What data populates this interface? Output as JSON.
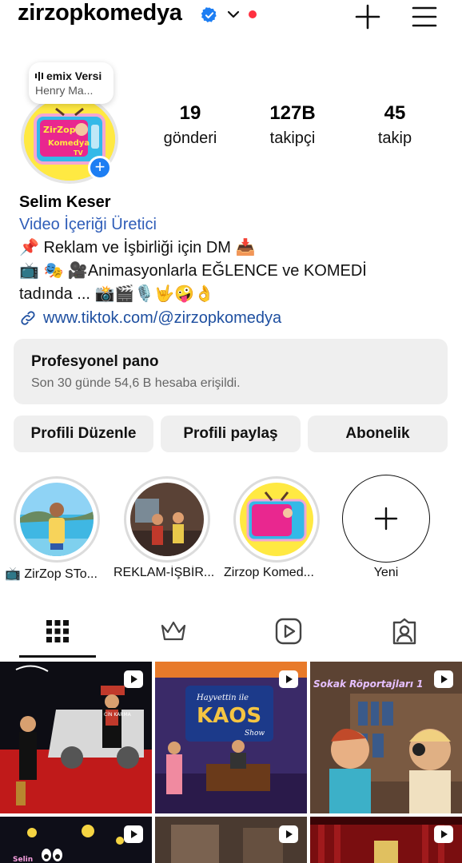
{
  "header": {
    "username": "zirzopkomedya",
    "icons": [
      "verified-badge-icon",
      "chevron-down-icon",
      "notification-dot",
      "plus-icon",
      "menu-icon"
    ]
  },
  "profile": {
    "music_title": "emix Versi",
    "music_artist": "Henry Ma...",
    "avatar_text": [
      "ZirZop",
      "Komedya",
      "TV"
    ],
    "stats": [
      {
        "value": "19",
        "label": "gönderi"
      },
      {
        "value": "127B",
        "label": "takipçi"
      },
      {
        "value": "45",
        "label": "takip"
      }
    ]
  },
  "bio": {
    "name": "Selim Keser",
    "category": "Video İçeriği Üretici",
    "line1": "📌 Reklam ve İşbirliği  için DM 📥",
    "line2": "📺 🎭 🎥Animasyonlarla EĞLENCE ve KOMEDİ",
    "line3": "tadında ... 📸🎬🎙️🤟🤪👌",
    "link": "www.tiktok.com/@zirzopkomedya"
  },
  "dashboard": {
    "title": "Profesyonel pano",
    "subtitle": "Son 30 günde 54,6 B hesaba erişildi."
  },
  "buttons": {
    "edit": "Profili Düzenle",
    "share": "Profili paylaş",
    "subscribe": "Abonelik"
  },
  "highlights": [
    {
      "label": "📺 ZirZop STo..."
    },
    {
      "label": "REKLAM-İŞBİR..."
    },
    {
      "label": "Zirzop Komed..."
    }
  ],
  "highlight_new": {
    "label": "Yeni"
  },
  "tabs": [
    "grid-icon",
    "crown-icon",
    "reels-icon",
    "tagged-icon"
  ],
  "grid": {
    "post2_title": "Hayvettin ile",
    "post2_big": "KAOS",
    "post2_sub": "Show",
    "post3_title": "Sokak Röportajları 1",
    "post1_badge": "CİN KARMA",
    "post4_text": "Selin"
  },
  "colors": {
    "accent_blue": "#1d7ef3",
    "link_blue": "#1e4fa0",
    "red_dot": "#ff3040",
    "avatar_yellow": "#ffe942"
  }
}
